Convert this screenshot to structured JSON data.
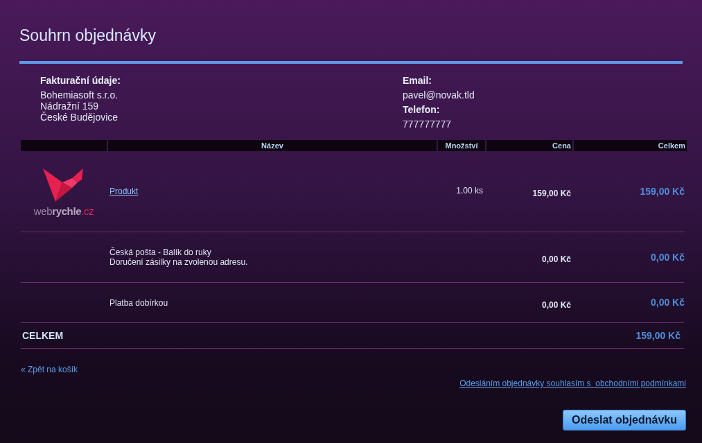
{
  "title": "Souhrn objednávky",
  "billing": {
    "label": "Fakturační údaje:",
    "lines": [
      "Bohemiasoft s.r.o.",
      "Nádražní 159",
      "České Budějovice"
    ]
  },
  "contact": [
    {
      "label": "Email:",
      "value": "pavel@novak.tld"
    },
    {
      "label": "Telefon:",
      "value": "777777777"
    }
  ],
  "table": {
    "columns": [
      "",
      "Název",
      "Množství",
      "Cena",
      "Celkem"
    ],
    "rows": [
      {
        "kind": "product",
        "logo": {
          "part_1": "web",
          "part_2": "rychle",
          "part_3": ".cz"
        },
        "name": "Produkt",
        "quantity": "1.00 ks",
        "price": "159,00 Kč",
        "total": "159,00 Kč"
      },
      {
        "kind": "service",
        "lines": [
          "Česká pošta - Balík do ruky",
          "Doručení zásilky na zvolenou adresu."
        ],
        "price": "0,00 Kč",
        "total": "0,00 Kč"
      },
      {
        "kind": "service",
        "lines": [
          "Platba dobírkou"
        ],
        "price": "0,00 Kč",
        "total": "0,00 Kč"
      }
    ],
    "total": {
      "label": "CELKEM",
      "value": "159,00 Kč"
    }
  },
  "back_link": "« Zpět na košík",
  "terms_link": "Odesláním objednávky souhlasím s  obchodními podmínkami",
  "submit_button": "Odeslat objednávku"
}
